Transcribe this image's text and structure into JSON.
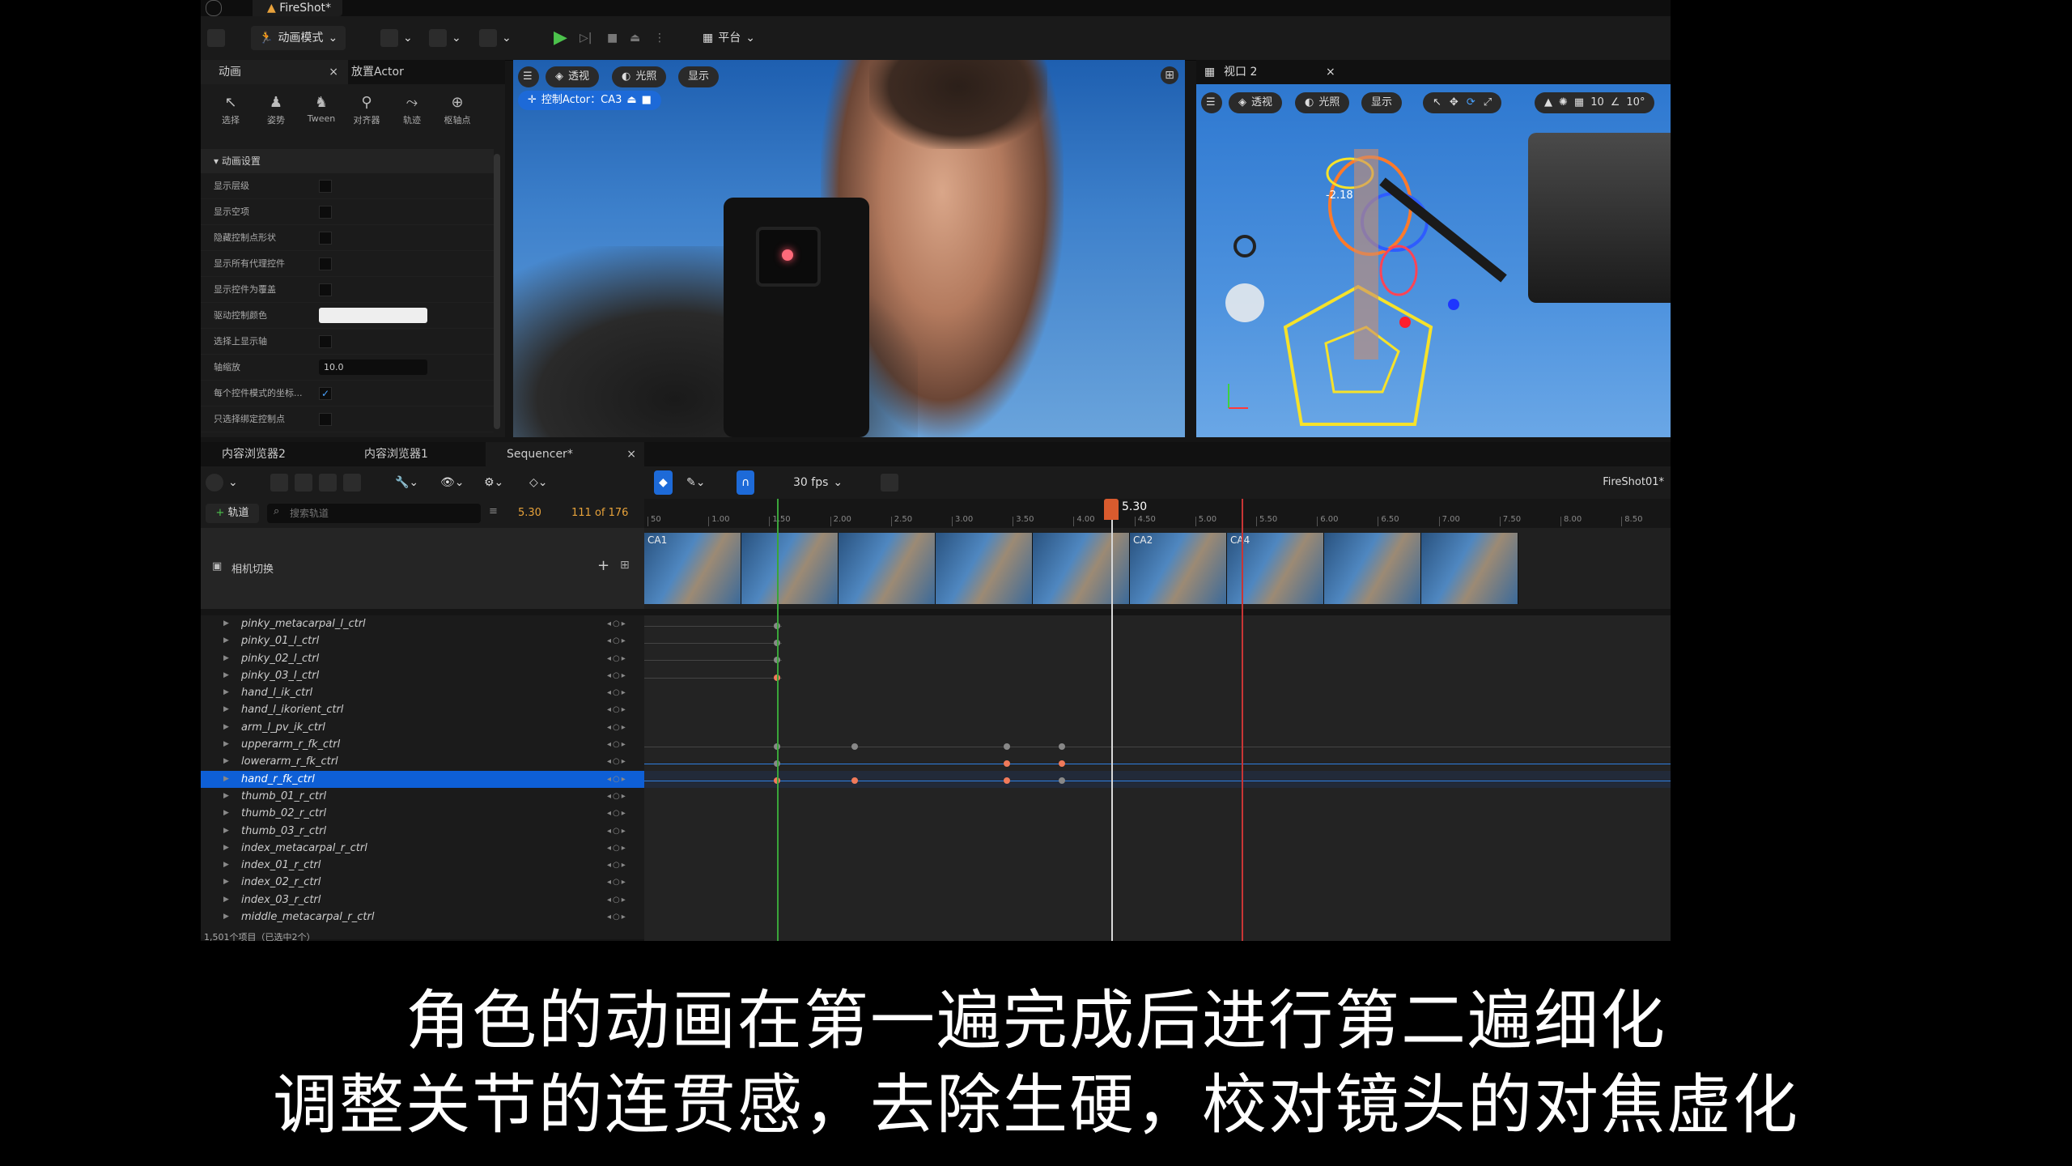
{
  "window": {
    "file_tab": "FireShot*"
  },
  "toolbar": {
    "mode_label": "动画模式",
    "platform_label": "平台"
  },
  "left_panel": {
    "tabs": [
      "动画",
      "放置Actor"
    ],
    "modes": [
      "选择",
      "姿势",
      "Tween",
      "对齐器",
      "轨迹",
      "枢轴点"
    ],
    "section": "动画设置",
    "rows": [
      {
        "label": "显示层级",
        "type": "check",
        "on": false
      },
      {
        "label": "显示空项",
        "type": "check",
        "on": false
      },
      {
        "label": "隐藏控制点形状",
        "type": "check",
        "on": false
      },
      {
        "label": "显示所有代理控件",
        "type": "check",
        "on": false
      },
      {
        "label": "显示控件为覆盖",
        "type": "check",
        "on": false
      },
      {
        "label": "驱动控制颜色",
        "type": "swatch"
      },
      {
        "label": "选择上显示轴",
        "type": "check",
        "on": false
      },
      {
        "label": "轴缩放",
        "type": "num",
        "value": "10.0"
      },
      {
        "label": "每个控件模式的坐标...",
        "type": "check",
        "on": true
      },
      {
        "label": "只选择绑定控制点",
        "type": "check",
        "on": false
      }
    ]
  },
  "viewport1": {
    "perspective": "透视",
    "lighting": "光照",
    "show": "显示",
    "pilot": "控制Actor：CA3"
  },
  "viewport2": {
    "title": "视口 2",
    "perspective": "透视",
    "lighting": "光照",
    "show": "显示",
    "grid": "10",
    "angle": "10°",
    "readout": "-2.18"
  },
  "bottom_tabs": [
    "内容浏览器2",
    "内容浏览器1",
    "Sequencer*"
  ],
  "sequencer": {
    "fps": "30 fps",
    "sequence_name": "FireShot01*",
    "add_track": "轨道",
    "search_placeholder": "搜索轨道",
    "current_time": "5.30",
    "frame_count": "111 of 176",
    "playhead_label": "5.30",
    "camera_cut_label": "相机切换",
    "ruler_ticks": [
      "50",
      "1.00",
      "1.50",
      "2.00",
      "2.50",
      "3.00",
      "3.50",
      "4.00",
      "4.50",
      "5.00",
      "5.50",
      "6.00",
      "6.50",
      "7.00",
      "7.50",
      "8.00",
      "8.50"
    ],
    "camera_thumbs": [
      "CA1",
      "",
      "",
      "",
      "",
      "CA2",
      "CA4",
      "",
      ""
    ],
    "tracks": [
      "pinky_metacarpal_l_ctrl",
      "pinky_01_l_ctrl",
      "pinky_02_l_ctrl",
      "pinky_03_l_ctrl",
      "hand_l_ik_ctrl",
      "hand_l_ikorient_ctrl",
      "arm_l_pv_ik_ctrl",
      "upperarm_r_fk_ctrl",
      "lowerarm_r_fk_ctrl",
      "hand_r_fk_ctrl",
      "thumb_01_r_ctrl",
      "thumb_02_r_ctrl",
      "thumb_03_r_ctrl",
      "index_metacarpal_r_ctrl",
      "index_01_r_ctrl",
      "index_02_r_ctrl",
      "index_03_r_ctrl",
      "middle_metacarpal_r_ctrl"
    ],
    "selected_track": "hand_r_fk_ctrl",
    "footer": "1,501个项目（已选中2个）"
  },
  "subtitles": [
    "角色的动画在第一遍完成后进行第二遍细化",
    "调整关节的连贯感，去除生硬，校对镜头的对焦虚化"
  ]
}
